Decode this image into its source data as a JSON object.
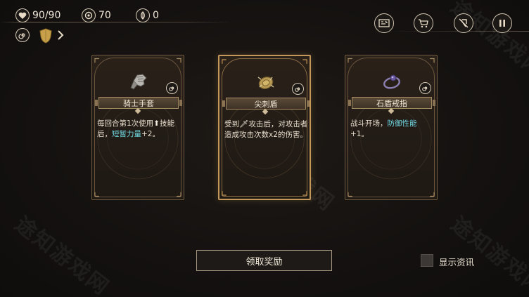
{
  "hud": {
    "hp": "90/90",
    "coins": "70",
    "soul": "0",
    "icons": [
      "heart-icon",
      "coin-icon",
      "soul-icon",
      "spiral-icon",
      "shield-icon",
      "chevron-right-icon"
    ]
  },
  "top_buttons": [
    "map-icon",
    "cart-icon",
    "no-tool-icon",
    "pause-icon"
  ],
  "cards": [
    {
      "name": "骑士手套",
      "icon": "gauntlet-icon",
      "desc_parts": [
        {
          "t": "每回合第1次使用",
          "hl": false
        },
        {
          "t": "⬆",
          "hl": false,
          "icon": true
        },
        {
          "t": "技能后，",
          "hl": false
        },
        {
          "t": "短暂力量",
          "hl": true
        },
        {
          "t": "+2。",
          "hl": false
        }
      ]
    },
    {
      "name": "尖刺盾",
      "icon": "spiked-shield-icon",
      "selected": true,
      "desc_parts": [
        {
          "t": "受到",
          "hl": false
        },
        {
          "t": "🗡",
          "hl": false,
          "icon": true
        },
        {
          "t": "攻击后，对攻击者造成攻击次数x2的伤害。",
          "hl": false
        }
      ]
    },
    {
      "name": "石盾戒指",
      "icon": "ring-icon",
      "desc_parts": [
        {
          "t": "战斗开场，",
          "hl": false
        },
        {
          "t": "防御性能",
          "hl": true
        },
        {
          "t": "+1。",
          "hl": false
        }
      ]
    }
  ],
  "claim_button": "领取奖励",
  "show_info_label": "显示资讯",
  "show_info_checked": false,
  "colors": {
    "highlight": "#6fd6e0",
    "card_border": "#6e5a40",
    "selected_border": "#c4985a",
    "background": "#151210"
  }
}
